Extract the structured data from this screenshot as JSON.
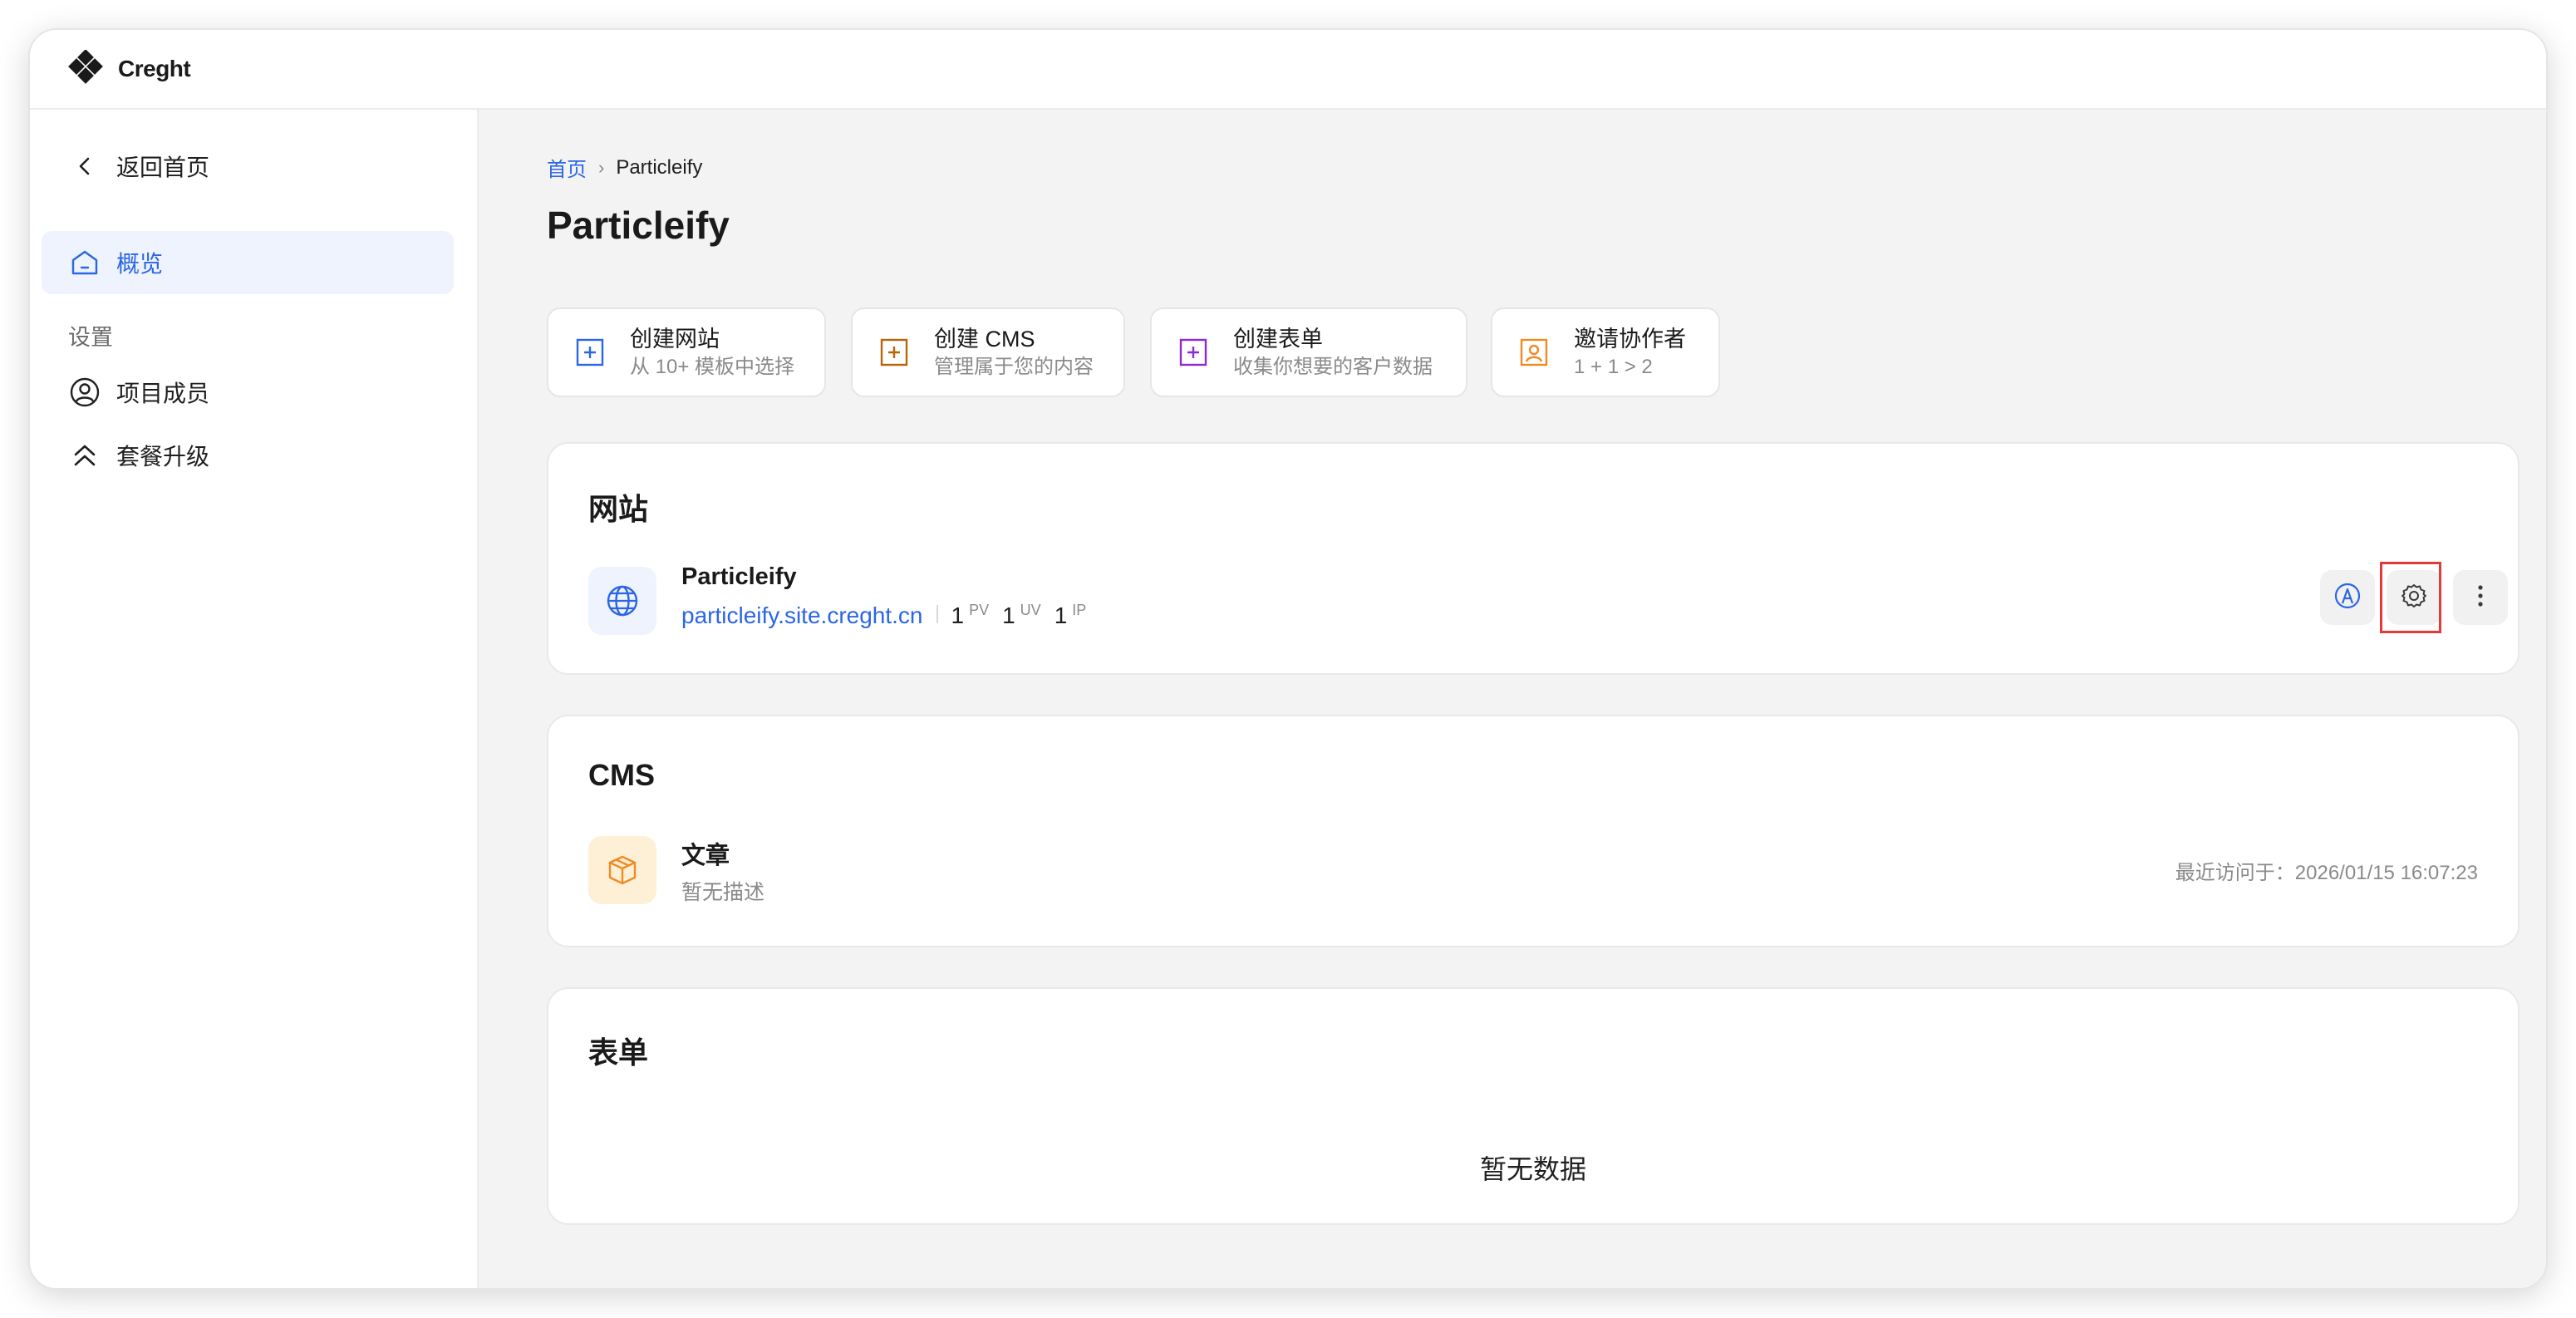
{
  "app": {
    "brand": "Creght"
  },
  "sidebar": {
    "back": "返回首页",
    "overview": "概览",
    "settings_section": "设置",
    "members": "项目成员",
    "upgrade": "套餐升级"
  },
  "breadcrumb": {
    "home": "首页",
    "current": "Particleify"
  },
  "page": {
    "title": "Particleify"
  },
  "quick_actions": [
    {
      "title": "创建网站",
      "subtitle": "从 10+ 模板中选择",
      "icon": "plus-square-icon",
      "color": "#2b66e6"
    },
    {
      "title": "创建 CMS",
      "subtitle": "管理属于您的内容",
      "icon": "plus-square-icon",
      "color": "#b8650a"
    },
    {
      "title": "创建表单",
      "subtitle": "收集你想要的客户数据",
      "icon": "plus-square-icon",
      "color": "#8a2bd6"
    },
    {
      "title": "邀请协作者",
      "subtitle": "1 + 1 > 2",
      "icon": "user-square-icon",
      "color": "#f08a24"
    }
  ],
  "websites": {
    "title": "网站",
    "item": {
      "name": "Particleify",
      "url": "particleify.site.creght.cn",
      "pv_value": "1",
      "pv_label": "PV",
      "uv_value": "1",
      "uv_label": "UV",
      "ip_value": "1",
      "ip_label": "IP"
    }
  },
  "cms": {
    "title": "CMS",
    "item": {
      "name": "文章",
      "description": "暂无描述",
      "last_visit": "最近访问于：2026/01/15 16:07:23"
    }
  },
  "forms": {
    "title": "表单",
    "empty": "暂无数据"
  },
  "colors": {
    "accent": "#2b66e6",
    "highlight": "#e53935"
  }
}
